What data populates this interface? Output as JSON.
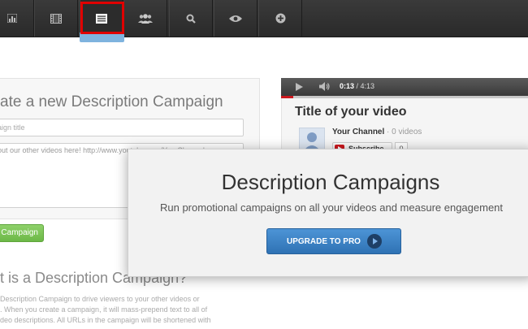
{
  "toolbar": {
    "active_index": 2,
    "buttons": [
      {
        "icon": "bar-chart-icon"
      },
      {
        "icon": "film-icon"
      },
      {
        "icon": "description-list-icon"
      },
      {
        "icon": "users-icon"
      },
      {
        "icon": "search-icon"
      },
      {
        "icon": "eye-icon"
      },
      {
        "icon": "plus-circle-icon"
      }
    ]
  },
  "campaign_form": {
    "title": "ate a new Description Campaign",
    "title_placeholder": "aign title",
    "description_text": "out our other videos here! http://www.youtube.com/YourChannel",
    "create_button": "Campaign"
  },
  "what_is": {
    "title": "t is a Description Campaign?",
    "body_lines": [
      "Description Campaign to drive viewers to your other videos or",
      ". When you create a campaign, it will mass-prepend text to all of",
      "deo descriptions. All URLs in the campaign will be shortened with"
    ]
  },
  "video": {
    "current_time": "0:13",
    "duration": "/ 4:13",
    "progress_fraction": 0.05,
    "title": "Title of your video",
    "channel_name": "Your Channel",
    "channel_meta": "· 0 videos",
    "subscribe_label": "Subscribe",
    "subscriber_count": "0"
  },
  "upgrade_modal": {
    "title": "Description Campaigns",
    "subtitle": "Run promotional campaigns on all your videos and measure engagement",
    "button_label": "UPGRADE TO PRO"
  },
  "colors": {
    "highlight": "#e00000",
    "upgrade_button": "#3a83c6",
    "campaign_button": "#7cc558"
  }
}
